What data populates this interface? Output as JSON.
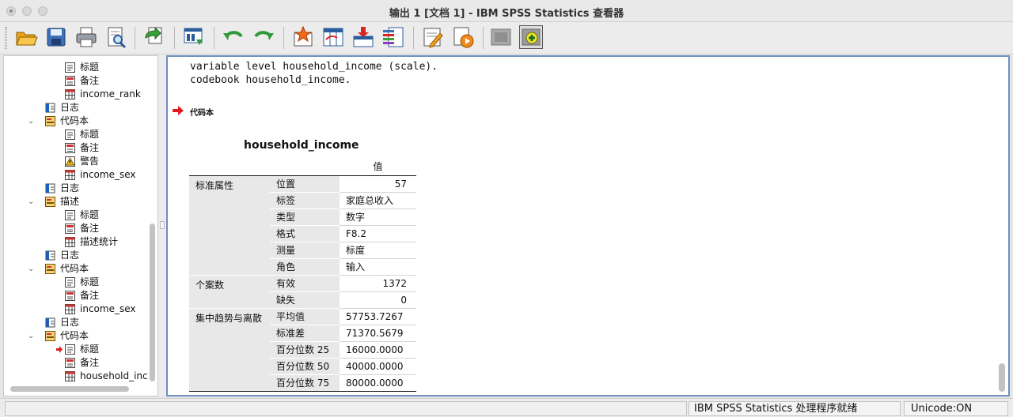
{
  "window": {
    "title": "输出 1 [文档 1] - IBM SPSS Statistics 查看器"
  },
  "toolbar": {
    "buttons": [
      "open-icon",
      "save-icon",
      "print-icon",
      "print-preview-icon",
      "export-icon",
      "goto-data-icon",
      "undo-icon",
      "redo-icon",
      "goto-output-icon",
      "variables-icon",
      "insert-case-icon",
      "split-file-icon",
      "designate-window-icon",
      "run-icon",
      "collapse-icon",
      "expand-icon"
    ]
  },
  "tree": {
    "items": [
      {
        "label": "标题"
      },
      {
        "label": "备注"
      },
      {
        "label": "income_rank"
      },
      {
        "label": "日志"
      },
      {
        "label": "代码本"
      },
      {
        "label": "标题"
      },
      {
        "label": "备注"
      },
      {
        "label": "警告"
      },
      {
        "label": "income_sex"
      },
      {
        "label": "日志"
      },
      {
        "label": "描述"
      },
      {
        "label": "标题"
      },
      {
        "label": "备注"
      },
      {
        "label": "描述统计"
      },
      {
        "label": "日志"
      },
      {
        "label": "代码本"
      },
      {
        "label": "标题"
      },
      {
        "label": "备注"
      },
      {
        "label": "income_sex"
      },
      {
        "label": "日志"
      },
      {
        "label": "代码本"
      },
      {
        "label": "标题"
      },
      {
        "label": "备注"
      },
      {
        "label": "household_inc"
      }
    ]
  },
  "output": {
    "syntax_line1": "variable level household_income (scale).",
    "syntax_line2": "codebook household_income.",
    "section_title": "代码本",
    "table_title": "household_income",
    "value_header": "值",
    "groups": {
      "standard": "标准属性",
      "cases": "个案数",
      "central": "集中趋势与离散"
    },
    "rows": [
      {
        "label": "位置",
        "value": "57"
      },
      {
        "label": "标签",
        "value": "家庭总收入"
      },
      {
        "label": "类型",
        "value": "数字"
      },
      {
        "label": "格式",
        "value": "F8.2"
      },
      {
        "label": "测量",
        "value": "标度"
      },
      {
        "label": "角色",
        "value": "输入"
      },
      {
        "label": "有效",
        "value": "1372"
      },
      {
        "label": "缺失",
        "value": "0"
      },
      {
        "label": "平均值",
        "value": "57753.7267"
      },
      {
        "label": "标准差",
        "value": "71370.5679"
      },
      {
        "label": "百分位数 25",
        "value": "16000.0000"
      },
      {
        "label": "百分位数 50",
        "value": "40000.0000"
      },
      {
        "label": "百分位数 75",
        "value": "80000.0000"
      }
    ]
  },
  "status": {
    "processor": "IBM SPSS Statistics 处理程序就绪",
    "unicode": "Unicode:ON"
  }
}
